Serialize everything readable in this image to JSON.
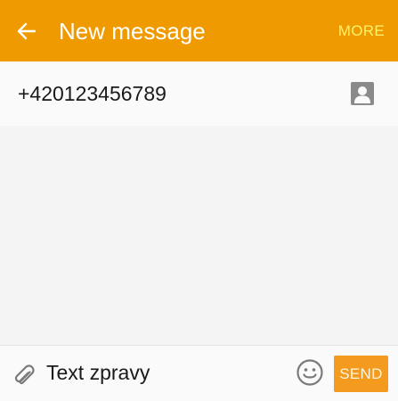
{
  "appbar": {
    "title": "New message",
    "more_label": "MORE",
    "back_icon": "arrow-left-icon",
    "background_color": "#ef9a00",
    "more_color": "#fff36b"
  },
  "recipient": {
    "value": "+420123456789",
    "contact_icon": "contact-icon"
  },
  "composer": {
    "message_value": "Text zpravy",
    "attach_icon": "paperclip-icon",
    "emoji_icon": "smiley-icon",
    "send_label": "SEND",
    "send_color": "#f49a1e"
  }
}
